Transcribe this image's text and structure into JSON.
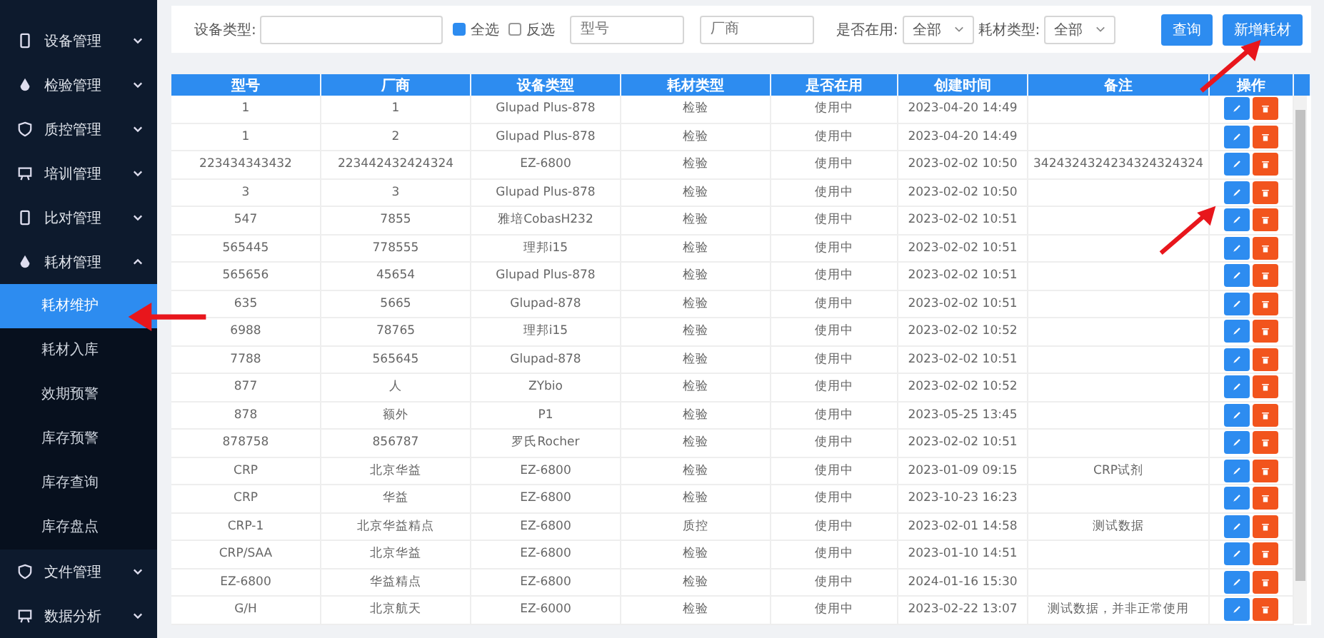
{
  "sidebar": {
    "items": [
      {
        "label": "设备管理",
        "expanded": false
      },
      {
        "label": "检验管理",
        "expanded": false
      },
      {
        "label": "质控管理",
        "expanded": false
      },
      {
        "label": "培训管理",
        "expanded": false
      },
      {
        "label": "比对管理",
        "expanded": false
      },
      {
        "label": "耗材管理",
        "expanded": true,
        "children": [
          {
            "label": "耗材维护",
            "selected": true
          },
          {
            "label": "耗材入库",
            "selected": false
          },
          {
            "label": "效期预警",
            "selected": false
          },
          {
            "label": "库存预警",
            "selected": false
          },
          {
            "label": "库存查询",
            "selected": false
          },
          {
            "label": "库存盘点",
            "selected": false
          }
        ]
      },
      {
        "label": "文件管理",
        "expanded": false
      },
      {
        "label": "数据分析",
        "expanded": false
      }
    ]
  },
  "filters": {
    "device_type": {
      "label": "设备类型:"
    },
    "select_all": {
      "label": "全选",
      "checked": true
    },
    "invert": {
      "label": "反选",
      "checked": false
    },
    "model": {
      "placeholder": "型号"
    },
    "maker": {
      "placeholder": "厂商"
    },
    "in_use": {
      "label": "是否在用:",
      "value": "全部"
    },
    "supply_type": {
      "label": "耗材类型:",
      "value": "全部"
    },
    "buttons": [
      "查询",
      "新增耗材"
    ]
  },
  "table": {
    "columns": [
      "型号",
      "厂商",
      "设备类型",
      "耗材类型",
      "是否在用",
      "创建时间",
      "备注",
      "操作"
    ],
    "rows": [
      [
        "1",
        "1",
        "Glupad Plus-878",
        "检验",
        "使用中",
        "2023-04-20 14:49",
        ""
      ],
      [
        "1",
        "2",
        "Glupad Plus-878",
        "检验",
        "使用中",
        "2023-04-20 14:49",
        ""
      ],
      [
        "223434343432",
        "223442432424324",
        "EZ-6800",
        "检验",
        "使用中",
        "2023-02-02 10:50",
        "3424324324234324324324"
      ],
      [
        "3",
        "3",
        "Glupad Plus-878",
        "检验",
        "使用中",
        "2023-02-02 10:50",
        ""
      ],
      [
        "547",
        "7855",
        "雅培CobasH232",
        "检验",
        "使用中",
        "2023-02-02 10:51",
        ""
      ],
      [
        "565445",
        "778555",
        "理邦i15",
        "检验",
        "使用中",
        "2023-02-02 10:51",
        ""
      ],
      [
        "565656",
        "45654",
        "Glupad Plus-878",
        "检验",
        "使用中",
        "2023-02-02 10:51",
        ""
      ],
      [
        "635",
        "5665",
        "Glupad-878",
        "检验",
        "使用中",
        "2023-02-02 10:51",
        ""
      ],
      [
        "6988",
        "78765",
        "理邦i15",
        "检验",
        "使用中",
        "2023-02-02 10:52",
        ""
      ],
      [
        "7788",
        "565645",
        "Glupad-878",
        "检验",
        "使用中",
        "2023-02-02 10:51",
        ""
      ],
      [
        "877",
        "人",
        "ZYbio",
        "检验",
        "使用中",
        "2023-02-02 10:52",
        ""
      ],
      [
        "878",
        "额外",
        "P1",
        "检验",
        "使用中",
        "2023-05-25 13:45",
        ""
      ],
      [
        "878758",
        "856787",
        "罗氏Rocher",
        "检验",
        "使用中",
        "2023-02-02 10:51",
        ""
      ],
      [
        "CRP",
        "北京华益",
        "EZ-6800",
        "检验",
        "使用中",
        "2023-01-09 09:15",
        "CRP试剂"
      ],
      [
        "CRP",
        "华益",
        "EZ-6800",
        "检验",
        "使用中",
        "2023-10-23 16:23",
        ""
      ],
      [
        "CRP-1",
        "北京华益精点",
        "EZ-6800",
        "质控",
        "使用中",
        "2023-02-01 14:58",
        "测试数据"
      ],
      [
        "CRP/SAA",
        "北京华益",
        "EZ-6800",
        "检验",
        "使用中",
        "2023-01-10 14:51",
        ""
      ],
      [
        "EZ-6800",
        "华益精点",
        "EZ-6800",
        "检验",
        "使用中",
        "2024-01-16 15:30",
        ""
      ],
      [
        "G/H",
        "北京航天",
        "EZ-6000",
        "检验",
        "使用中",
        "2023-02-22 13:07",
        "测试数据，并非正常使用"
      ]
    ]
  }
}
